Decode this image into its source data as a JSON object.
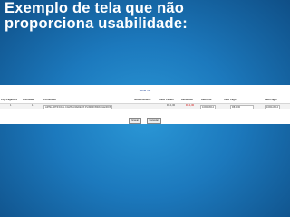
{
  "slide": {
    "title_line1": "Exemplo de tela que não",
    "title_line2": "proporciona usabilidade:"
  },
  "form": {
    "title": "Gerar NF",
    "headers": [
      "Loja Pagadora",
      "Prioridade",
      "Fornecedor",
      "Nossa Número",
      "Valor Pedido",
      "Remessas",
      "Data Entr.",
      "Valor Pago",
      "Data Pagto"
    ],
    "row": {
      "loja": "1",
      "prioridade": "1",
      "fornecedor": "ARTE ARTIFICIAL CAMISA REDEUX PLIMPRI BRASILEIROS",
      "nosso_numero": "",
      "valor_pedido": "R$ 1,00",
      "remessas": "R$ 1,00",
      "data_entr": "10/01/2014",
      "valor_pago": "R$ 1,00",
      "data_pagto": "10/01/2014"
    },
    "buttons": {
      "save": "Gravar",
      "cancel": "Cancelar"
    }
  }
}
